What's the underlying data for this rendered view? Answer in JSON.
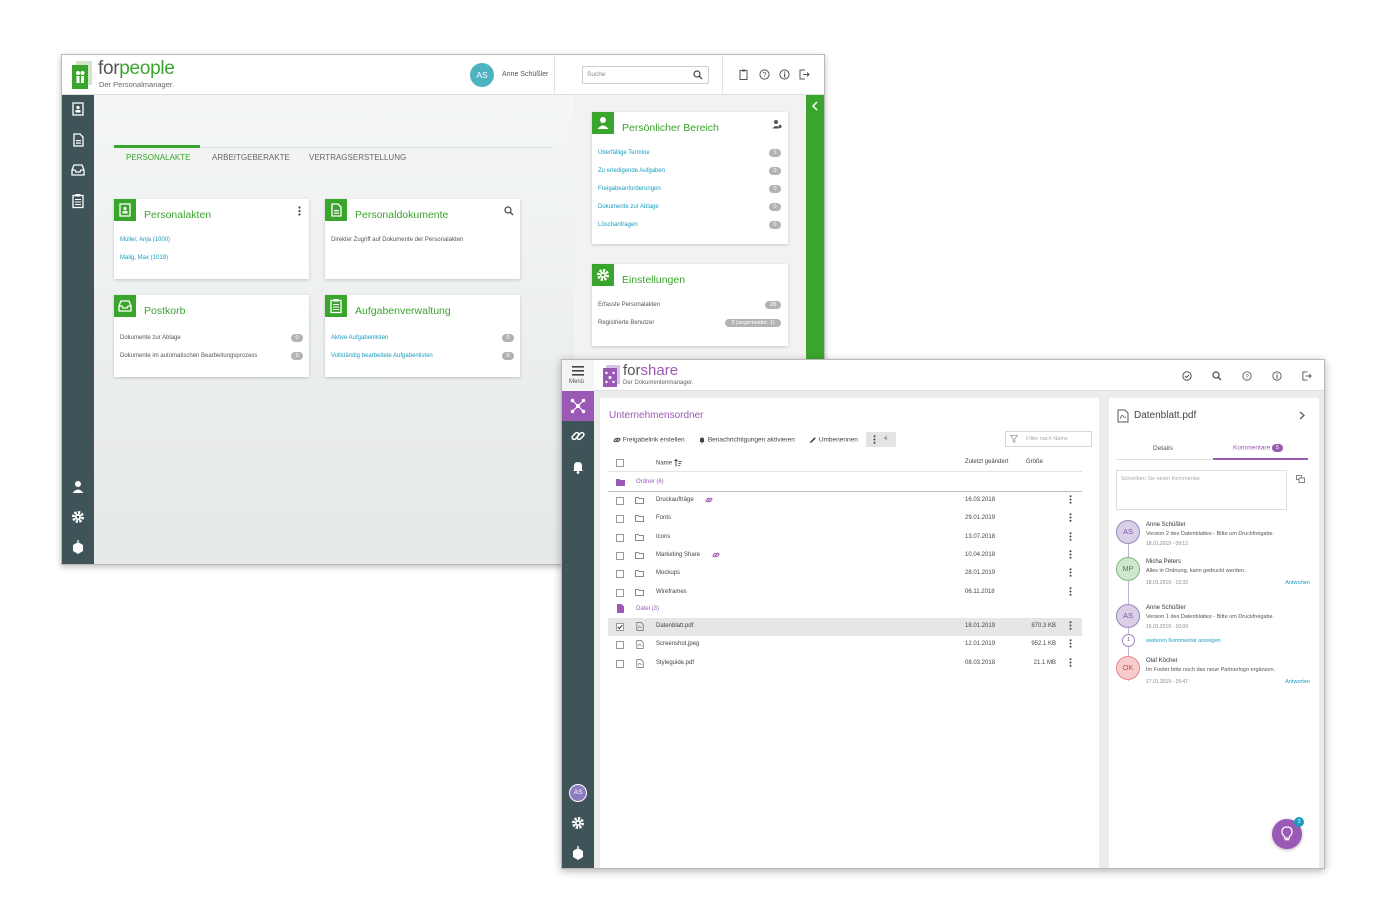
{
  "forpeople": {
    "logo_for": "for",
    "logo_people": "people",
    "tagline": "Der Personalmanager.",
    "user_initials": "AS",
    "user_name": "Anne Schüßler",
    "search_placeholder": "Suche",
    "tabs": [
      "PERSONALAKTE",
      "ARBEITGEBERAKTE",
      "VERTRAGSERSTELLUNG"
    ],
    "cards": {
      "personalakten": {
        "title": "Personalakten",
        "items": [
          "Müller, Anja (1000)",
          "Malig, Max (1019)"
        ]
      },
      "personaldokumente": {
        "title": "Personaldokumente",
        "desc": "Direkter Zugriff auf Dokumente der Personalakten"
      },
      "postkorb": {
        "title": "Postkorb",
        "items": [
          {
            "label": "Dokumente zur Ablage",
            "count": "0"
          },
          {
            "label": "Dokumente im automatischen Bearbeitungsprozess",
            "count": "0"
          }
        ]
      },
      "aufgaben": {
        "title": "Aufgabenverwaltung",
        "items": [
          {
            "label": "Aktive Aufgabenlisten",
            "count": "0"
          },
          {
            "label": "Vollständig bearbeitete Aufgabenlisten",
            "count": "0"
          }
        ]
      }
    },
    "persoenlich": {
      "title": "Persönlicher Bereich",
      "items": [
        {
          "label": "Überfällige Termine",
          "count": "1"
        },
        {
          "label": "Zu erledigende Aufgaben",
          "count": "0"
        },
        {
          "label": "Freigabeanforderungen",
          "count": "0"
        },
        {
          "label": "Dokumente zur Ablage",
          "count": "0"
        },
        {
          "label": "Löschanfragen",
          "count": "0"
        }
      ]
    },
    "einstellungen": {
      "title": "Einstellungen",
      "items": [
        {
          "label": "Erfasste Personalakten",
          "count": "28"
        },
        {
          "label": "Registrierte Benutzer",
          "count": "3 (angemeldet: 1)"
        }
      ]
    }
  },
  "forshare": {
    "menu_label": "Menü",
    "logo_for": "for",
    "logo_share": "share",
    "tagline": "Der Dokumentenmanager.",
    "folder_title": "Unternehmensordner",
    "toolbar": {
      "share": "Freigabelink erstellen",
      "notify": "Benachrichtigungen aktivieren",
      "rename": "Umbenennen",
      "more_count": "4"
    },
    "filter_placeholder": "Filter nach Name",
    "columns": {
      "name": "Name",
      "changed": "Zuletzt geändert",
      "size": "Größe"
    },
    "group_folders": "Ordner (6)",
    "group_files": "Datei (3)",
    "folders": [
      {
        "name": "Druckaufträge",
        "date": "16.03.2018",
        "linked": true
      },
      {
        "name": "Fonts",
        "date": "29.01.2019",
        "linked": false
      },
      {
        "name": "Icons",
        "date": "13.07.2018",
        "linked": false
      },
      {
        "name": "Marketing Share",
        "date": "10.04.2018",
        "linked": true
      },
      {
        "name": "Mockups",
        "date": "28.01.2019",
        "linked": false
      },
      {
        "name": "Wireframes",
        "date": "06.11.2018",
        "linked": false
      }
    ],
    "files": [
      {
        "name": "Datenblatt.pdf",
        "date": "18.01.2019",
        "size": "870.3 KB",
        "selected": true
      },
      {
        "name": "Screenshot.jpeg",
        "date": "12.01.2019",
        "size": "952.1 KB",
        "selected": false
      },
      {
        "name": "Styleguide.pdf",
        "date": "08.03.2018",
        "size": "21.1 MB",
        "selected": false
      }
    ],
    "detail": {
      "file_name": "Datenblatt.pdf",
      "tab_details": "Details",
      "tab_comments": "Kommentare",
      "comment_count": "5",
      "comment_placeholder": "Schreiben Sie einen Kommentar",
      "reply": "Antworten",
      "more_comments": "weiteren Kommentar anzeigen",
      "more_count": "1",
      "comments": [
        {
          "initials": "AS",
          "author": "Anne Schüßler",
          "text": "Version 2 des Datenblattes - Bitte um Druckfreigabe.",
          "time": "18.01.2019 - 09:12"
        },
        {
          "initials": "MP",
          "author": "Micha Peters",
          "text": "Alles in Ordnung, kann gedruckt werden.",
          "time": "18.01.2019 - 13:32"
        },
        {
          "initials": "AS",
          "author": "Anne Schüßler",
          "text": "Version 1 des Datenblattes - Bitte um Druckfreigabe.",
          "time": "16.01.2019 - 10:09"
        },
        {
          "initials": "OK",
          "author": "Olaf Köcher",
          "text": "Im Footer bitte noch das neue Partnerlogo ergänzen.",
          "time": "17.01.2019 - 15:47"
        }
      ]
    },
    "sidebar_user": "AS",
    "help_badge": "3"
  },
  "colors": {
    "green": "#3aa52d",
    "purple": "#9b59b6",
    "sidebar": "#3e5458",
    "link": "#1a9dbf"
  }
}
